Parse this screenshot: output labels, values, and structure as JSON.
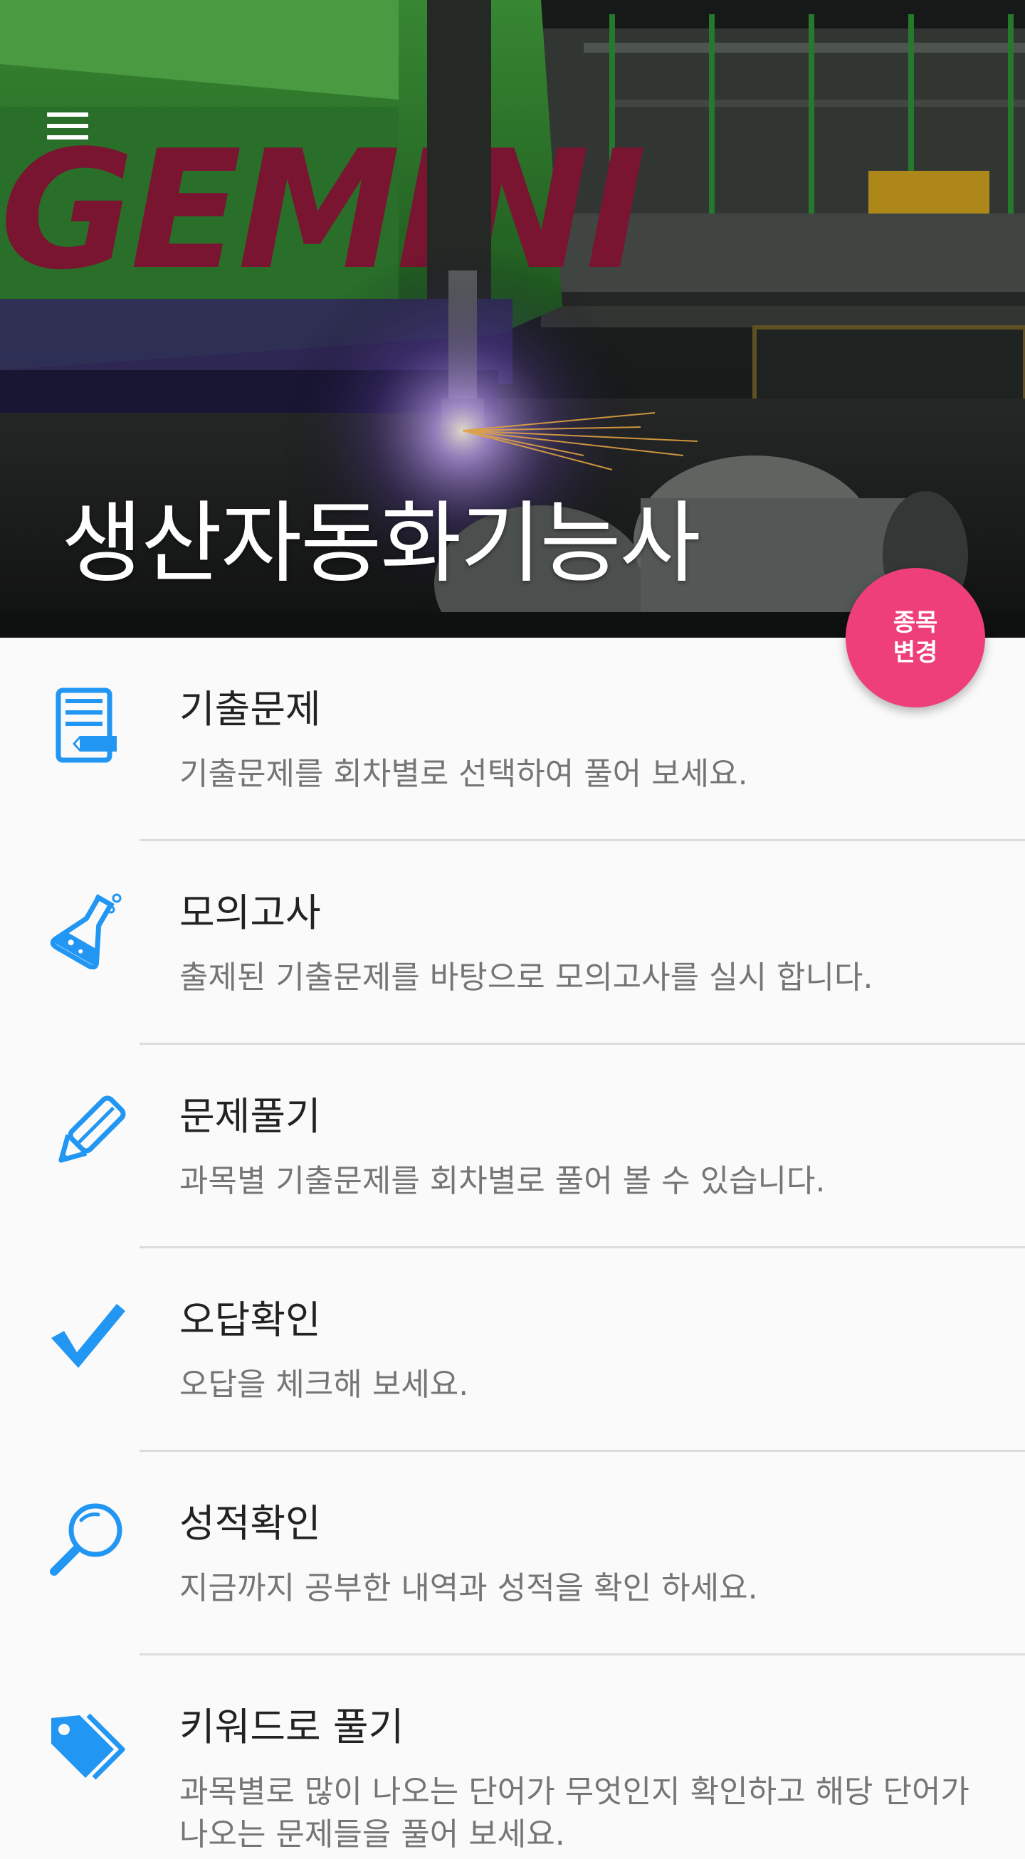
{
  "header": {
    "title": "생산자동화기능사",
    "menu_icon": "hamburger-menu-icon"
  },
  "fab": {
    "label": "종목\n변경",
    "color": "#ee3f7a"
  },
  "accent_color": "#2196f3",
  "menu_items": [
    {
      "title": "기출문제",
      "desc": "기출문제를 회차별로 선택하여 풀어 보세요.",
      "icon": "document-icon"
    },
    {
      "title": "모의고사",
      "desc": "출제된 기출문제를 바탕으로 모의고사를 실시 합니다.",
      "icon": "flask-icon"
    },
    {
      "title": "문제풀기",
      "desc": "과목별 기출문제를 회차별로 풀어 볼 수 있습니다.",
      "icon": "pencil-icon"
    },
    {
      "title": "오답확인",
      "desc": "오답을 체크해 보세요.",
      "icon": "check-icon"
    },
    {
      "title": "성적확인",
      "desc": "지금까지 공부한 내역과 성적을 확인 하세요.",
      "icon": "magnifier-icon"
    },
    {
      "title": "키워드로 풀기",
      "desc": "과목별로 많이 나오는 단어가 무엇인지 확인하고 해당 단어가 나오는 문제들을 풀어 보세요.",
      "icon": "tag-icon"
    }
  ]
}
